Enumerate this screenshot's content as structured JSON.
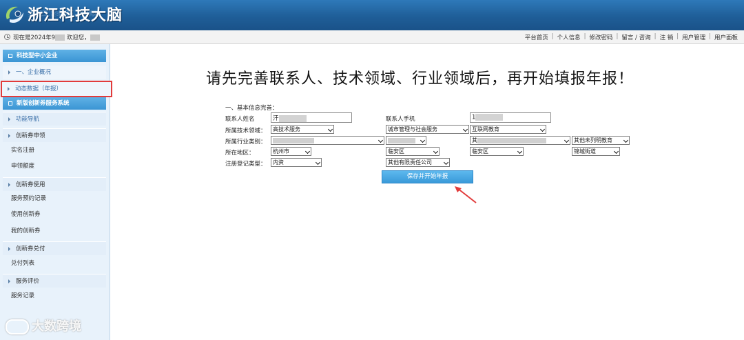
{
  "header": {
    "title": "浙江科技大脑"
  },
  "topbar": {
    "welcome_prefix": "现在是2024年9",
    "welcome_suffix": "欢迎您，",
    "links": [
      "平台首页",
      "个人信息",
      "修改密码",
      "留言 / 咨询",
      "注 销",
      "用户管理",
      "用户面板"
    ]
  },
  "sidebar": {
    "sections": [
      {
        "title": "科技型中小企业"
      },
      {
        "title": "新版创新券服务系统"
      }
    ],
    "items": {
      "overview": "一、企业概况",
      "dynamic": "动态数据（年报）",
      "nav": "功能导航",
      "apply_group": "创新券申领",
      "realname": "实名注册",
      "quota": "申领额度",
      "use_group": "创新券使用",
      "booking": "服务预约记录",
      "use_voucher": "使用创新券",
      "my_voucher": "我的创新券",
      "cash_group": "创新券兑付",
      "cash_list": "兑付列表",
      "eval_group": "服务评价",
      "service_record": "服务记录"
    }
  },
  "watermark": "大数跨境",
  "main": {
    "title": "请先完善联系人、技术领域、行业领域后，再开始填报年报！",
    "section": "一、基本信息完善：",
    "labels": {
      "contact_name": "联系人姓名",
      "contact_phone": "联系人手机",
      "tech_field": "所属技术领域：",
      "industry": "所属行业类别：",
      "region": "所在地区：",
      "reg_type": "注册登记类型："
    },
    "values": {
      "name_prefix": "汗",
      "phone_prefix": "1",
      "tech1": "高技术服务",
      "tech2": "城市管理与社会服务",
      "tech3": "互联网教育",
      "ind3_prefix": "其",
      "ind4": "其他未列明教育",
      "city": "杭州市",
      "district1": "临安区",
      "district2": "临安区",
      "street": "锦城街道",
      "reg1": "内资",
      "reg2": "其他有限责任公司"
    },
    "save_button": "保存并开始年报"
  },
  "colors": {
    "header_blue": "#1f5e98",
    "highlight_red": "#e23b3b",
    "button_blue": "#3a9ad9"
  }
}
